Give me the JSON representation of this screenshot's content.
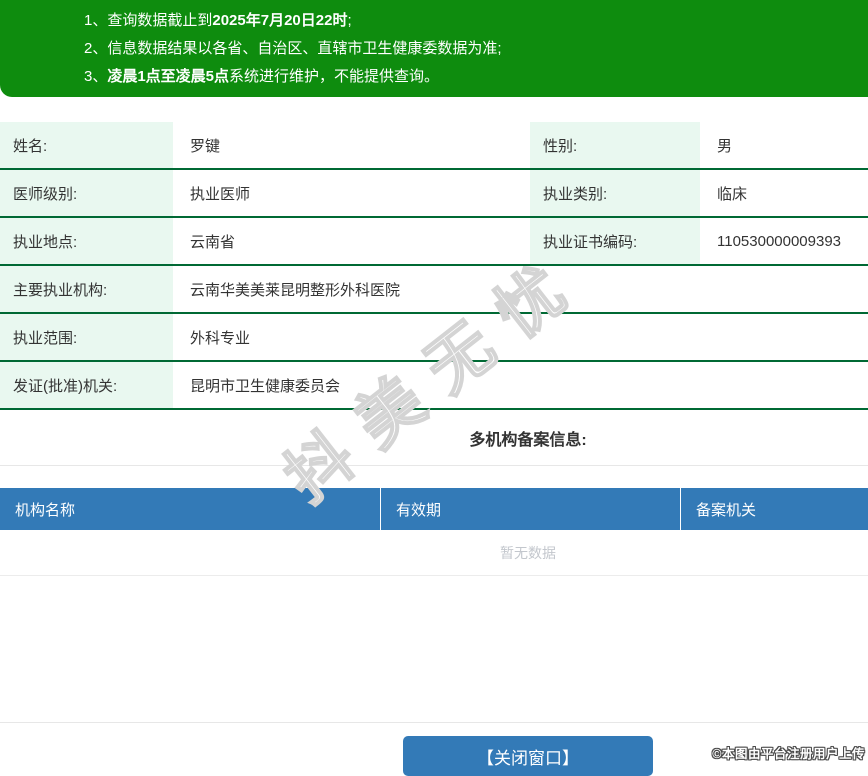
{
  "notice": {
    "lines": [
      {
        "num": "1、",
        "pre": "查询数据截止到",
        "bold": "2025年7月20日22时",
        "post": ";"
      },
      {
        "num": "2、",
        "pre": "信息数据结果以各省、自治区、直辖市卫生健康委数据为准;",
        "bold": "",
        "post": ""
      },
      {
        "num": "3、",
        "pre": "",
        "bold": "凌晨1点至凌晨5点",
        "post": "系统进行维护，不能提供查询。"
      }
    ]
  },
  "info": {
    "rows": [
      {
        "label": "姓名:",
        "value": "罗键",
        "label2": "性别:",
        "value2": "男"
      },
      {
        "label": "医师级别:",
        "value": "执业医师",
        "label2": "执业类别:",
        "value2": "临床"
      },
      {
        "label": "执业地点:",
        "value": "云南省",
        "label2": "执业证书编码:",
        "value2": "110530000009393"
      },
      {
        "label": "主要执业机构:",
        "value": "云南华美美莱昆明整形外科医院"
      },
      {
        "label": "执业范围:",
        "value": "外科专业"
      },
      {
        "label": "发证(批准)机关:",
        "value": "昆明市卫生健康委员会"
      }
    ]
  },
  "multi_org": {
    "title": "多机构备案信息:",
    "columns": [
      "机构名称",
      "有效期",
      "备案机关"
    ],
    "empty_text": "暂无数据"
  },
  "watermark": {
    "text": "抖美无忧"
  },
  "footer": {
    "close_button": "【关闭窗口】",
    "copyright": "©本图由平台注册用户上传"
  },
  "colors": {
    "banner_green": "#0e8c0e",
    "label_bg": "#e9f8f0",
    "row_border": "#006934",
    "header_blue": "#337ab7",
    "button_blue": "#337ab7",
    "empty_text_color": "#c3c7cd"
  }
}
